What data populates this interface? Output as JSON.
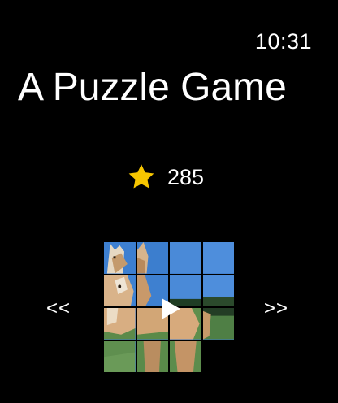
{
  "status": {
    "time": "10:31"
  },
  "header": {
    "title": "A Puzzle Game"
  },
  "score": {
    "value": "285",
    "icon": "star-icon",
    "color": "#f7c600"
  },
  "navigation": {
    "prev_label": "<<",
    "next_label": ">>"
  },
  "puzzle": {
    "grid_size": 4,
    "empty_tile": 16,
    "controls": {
      "play_icon": "play-icon"
    }
  }
}
